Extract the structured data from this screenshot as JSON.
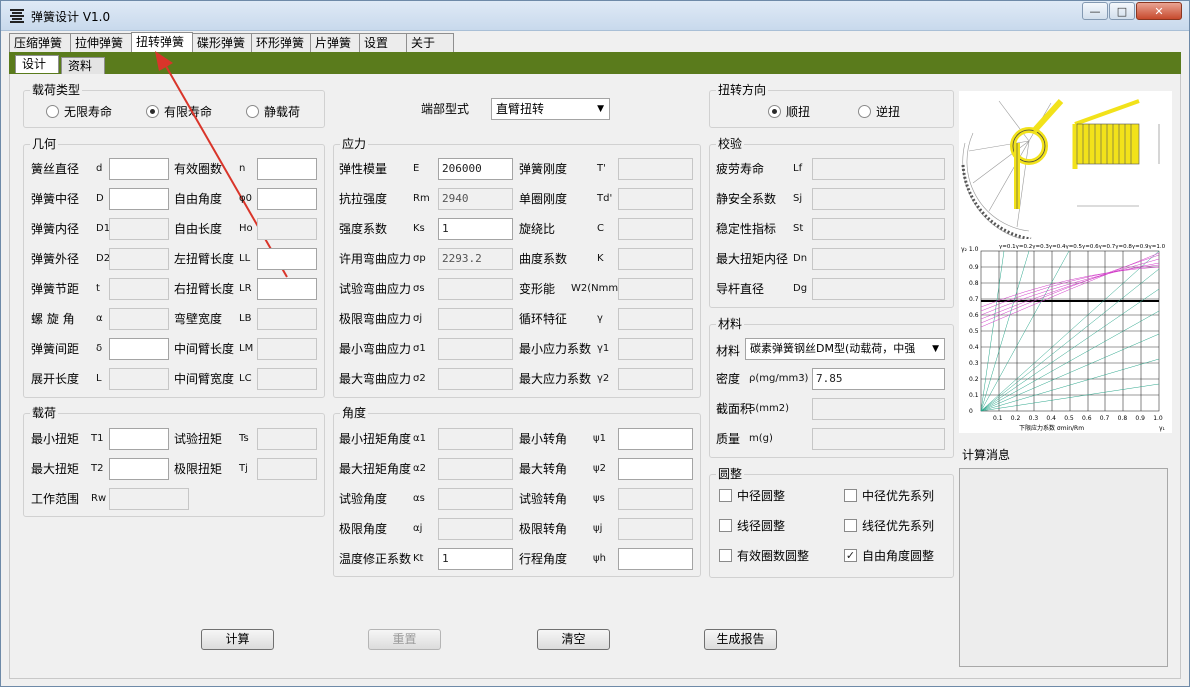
{
  "window": {
    "title": "弹簧设计  V1.0"
  },
  "main_tabs": [
    "压缩弹簧",
    "拉伸弹簧",
    "扭转弹簧",
    "碟形弹簧",
    "环形弹簧",
    "片弹簧",
    "设置",
    "关于"
  ],
  "sub_tabs": [
    "设计",
    "资料"
  ],
  "load_type": {
    "title": "载荷类型",
    "options": [
      "无限寿命",
      "有限寿命",
      "静载荷"
    ]
  },
  "end_type": {
    "label": "端部型式",
    "value": "直臂扭转"
  },
  "direction": {
    "title": "扭转方向",
    "options": [
      "顺扭",
      "逆扭"
    ]
  },
  "geometry": {
    "title": "几何",
    "left": [
      {
        "label": "簧丝直径",
        "sym": "d",
        "value": ""
      },
      {
        "label": "弹簧中径",
        "sym": "D",
        "value": ""
      },
      {
        "label": "弹簧内径",
        "sym": "D1",
        "value": ""
      },
      {
        "label": "弹簧外径",
        "sym": "D2",
        "value": ""
      },
      {
        "label": "弹簧节距",
        "sym": "t",
        "value": ""
      },
      {
        "label": "螺 旋 角",
        "sym": "α",
        "value": ""
      },
      {
        "label": "弹簧间距",
        "sym": "δ",
        "value": ""
      },
      {
        "label": "展开长度",
        "sym": "L",
        "value": ""
      }
    ],
    "right": [
      {
        "label": "有效圈数",
        "sym": "n",
        "value": ""
      },
      {
        "label": "自由角度",
        "sym": "φ0",
        "value": ""
      },
      {
        "label": "自由长度",
        "sym": "Ho",
        "value": ""
      },
      {
        "label": "左扭臂长度",
        "sym": "LL",
        "value": ""
      },
      {
        "label": "右扭臂长度",
        "sym": "LR",
        "value": ""
      },
      {
        "label": "弯壁宽度",
        "sym": "LB",
        "value": ""
      },
      {
        "label": "中间臂长度",
        "sym": "LM",
        "value": ""
      },
      {
        "label": "中间臂宽度",
        "sym": "LC",
        "value": ""
      }
    ]
  },
  "load": {
    "title": "载荷",
    "rows": [
      {
        "label": "最小扭矩",
        "sym": "T1",
        "value": ""
      },
      {
        "label": "最大扭矩",
        "sym": "T2",
        "value": ""
      },
      {
        "label": "工作范围",
        "sym": "Rw",
        "value": ""
      }
    ],
    "right": [
      {
        "label": "试验扭矩",
        "sym": "Ts",
        "value": ""
      },
      {
        "label": "极限扭矩",
        "sym": "Tj",
        "value": ""
      }
    ]
  },
  "stress": {
    "title": "应力",
    "left": [
      {
        "label": "弹性模量",
        "sym": "E",
        "value": "206000"
      },
      {
        "label": "抗拉强度",
        "sym": "Rm",
        "value": "2940"
      },
      {
        "label": "强度系数",
        "sym": "Ks",
        "value": "1"
      },
      {
        "label": "许用弯曲应力",
        "sym": "σp",
        "value": "2293.2"
      },
      {
        "label": "试验弯曲应力",
        "sym": "σs",
        "value": ""
      },
      {
        "label": "极限弯曲应力",
        "sym": "σj",
        "value": ""
      },
      {
        "label": "最小弯曲应力",
        "sym": "σ1",
        "value": ""
      },
      {
        "label": "最大弯曲应力",
        "sym": "σ2",
        "value": ""
      }
    ],
    "right": [
      {
        "label": "弹簧刚度",
        "sym": "T'",
        "value": ""
      },
      {
        "label": "单圈刚度",
        "sym": "Td'",
        "value": ""
      },
      {
        "label": "旋绕比",
        "sym": "C",
        "value": ""
      },
      {
        "label": "曲度系数",
        "sym": "K",
        "value": ""
      },
      {
        "label": "变形能",
        "sym": "W2(Nmm)",
        "value": ""
      },
      {
        "label": "循环特征",
        "sym": "γ",
        "value": ""
      },
      {
        "label": "最小应力系数",
        "sym": "γ1",
        "value": ""
      },
      {
        "label": "最大应力系数",
        "sym": "γ2",
        "value": ""
      }
    ]
  },
  "angle": {
    "title": "角度",
    "left": [
      {
        "label": "最小扭矩角度",
        "sym": "α1",
        "value": ""
      },
      {
        "label": "最大扭矩角度",
        "sym": "α2",
        "value": ""
      },
      {
        "label": "试验角度",
        "sym": "αs",
        "value": ""
      },
      {
        "label": "极限角度",
        "sym": "αj",
        "value": ""
      },
      {
        "label": "温度修正系数",
        "sym": "Kt",
        "value": "1"
      }
    ],
    "right": [
      {
        "label": "最小转角",
        "sym": "ψ1",
        "value": ""
      },
      {
        "label": "最大转角",
        "sym": "ψ2",
        "value": ""
      },
      {
        "label": "试验转角",
        "sym": "ψs",
        "value": ""
      },
      {
        "label": "极限转角",
        "sym": "ψj",
        "value": ""
      },
      {
        "label": "行程角度",
        "sym": "ψh",
        "value": ""
      }
    ]
  },
  "check": {
    "title": "校验",
    "rows": [
      {
        "label": "疲劳寿命",
        "sym": "Lf",
        "value": ""
      },
      {
        "label": "静安全系数",
        "sym": "Sj",
        "value": ""
      },
      {
        "label": "稳定性指标",
        "sym": "St",
        "value": ""
      },
      {
        "label": "最大扭矩内径",
        "sym": "Dn",
        "value": ""
      },
      {
        "label": "导杆直径",
        "sym": "Dg",
        "value": ""
      }
    ]
  },
  "material": {
    "title": "材料",
    "material_label": "材料",
    "material_value": "碳素弹簧钢丝DM型(动载荷，中强",
    "rows": [
      {
        "label": "密度",
        "sym": "ρ(mg/mm3)",
        "value": "7.85"
      },
      {
        "label": "截面积",
        "sym": "S(mm2)",
        "value": ""
      },
      {
        "label": "质量",
        "sym": "m(g)",
        "value": ""
      }
    ]
  },
  "rounding": {
    "title": "圆整",
    "items": [
      {
        "label": "中径圆整",
        "checked": false
      },
      {
        "label": "中径优先系列",
        "checked": false
      },
      {
        "label": "线径圆整",
        "checked": false
      },
      {
        "label": "线径优先系列",
        "checked": false
      },
      {
        "label": "有效圈数圆整",
        "checked": false
      },
      {
        "label": "自由角度圆整",
        "checked": true
      }
    ]
  },
  "messages": {
    "title": "计算消息"
  },
  "buttons": {
    "calc": "计算",
    "reset": "重置",
    "clear": "清空",
    "report": "生成报告"
  },
  "graph": {
    "y_top": "γ₂ 1.0",
    "x_title": "下限应力系数 σmin/Rm",
    "x_axis_end": "γ₁",
    "series_label": "γ=0.1γ=0.2γ=0.3γ=0.4γ=0.5γ=0.6γ=0.7γ=0.8γ=0.9γ=1.0",
    "y_ticks": [
      "0.9",
      "0.8",
      "0.7",
      "0.6",
      "0.5",
      "0.4",
      "0.3",
      "0.2",
      "0.1",
      "0"
    ],
    "x_ticks": [
      "0.1",
      "0.2",
      "0.3",
      "0.4",
      "0.5",
      "0.6",
      "0.7",
      "0.8",
      "0.9",
      "1.0"
    ]
  },
  "colors": {
    "band": "#5a7b1c",
    "spring": "#f2e21a",
    "arrow": "#d9352a"
  }
}
